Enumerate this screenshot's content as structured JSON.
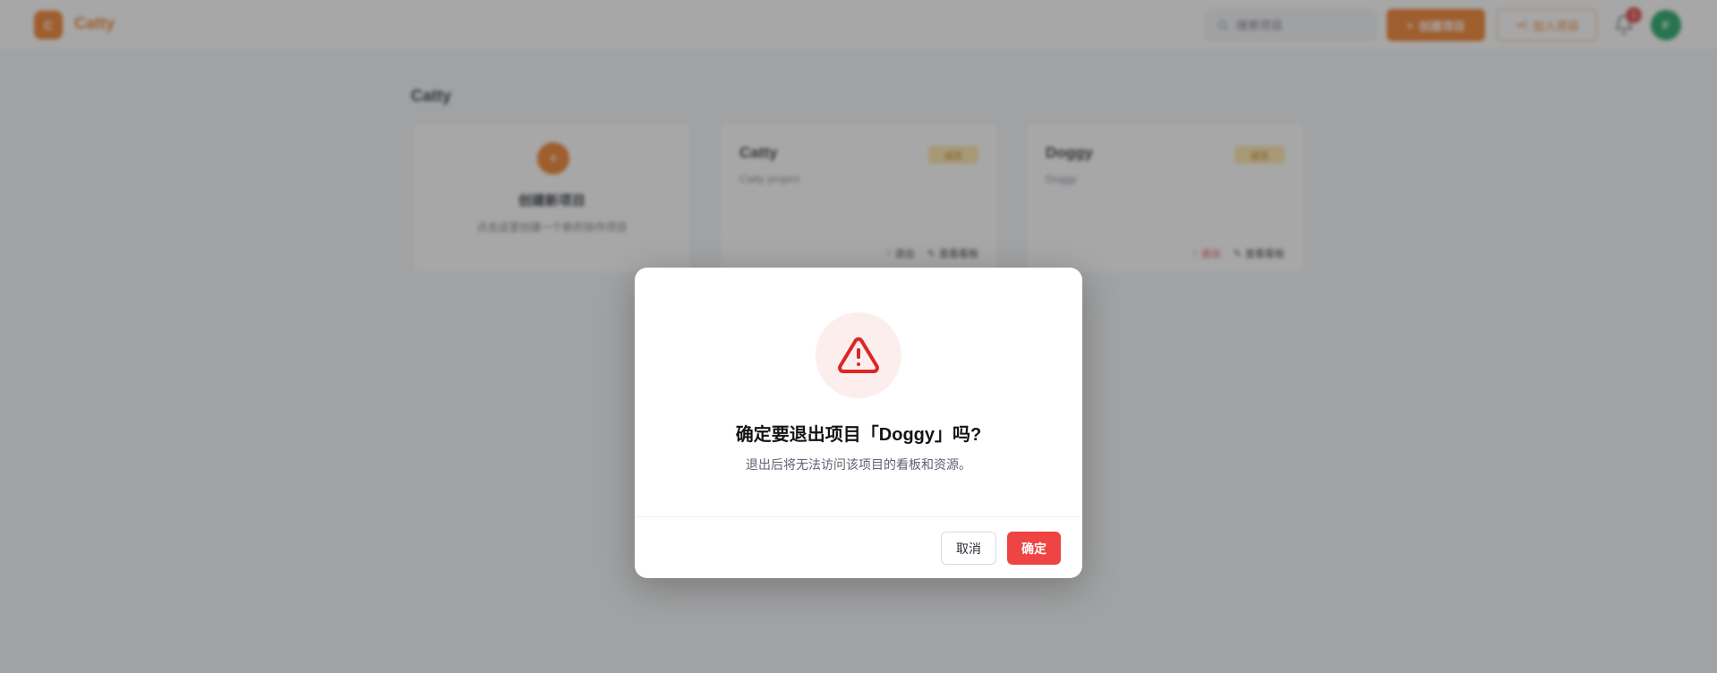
{
  "header": {
    "logo_letter": "C",
    "app_title": "Catty",
    "search_placeholder": "搜索项目",
    "create_button": "创建项目",
    "join_button": "加入项目",
    "notification_count": "1",
    "avatar_initial": "F"
  },
  "main": {
    "page_title": "Catty",
    "create_card": {
      "plus": "+",
      "title": "创建新项目",
      "subtitle": "点击这里创建一个新的协作项目"
    },
    "projects": [
      {
        "name": "Catty",
        "description": "Catty project",
        "badge": "成员",
        "action1": "退出",
        "action2": "查看看板"
      },
      {
        "name": "Doggy",
        "description": "Doggy",
        "badge": "成员",
        "action1": "退出",
        "action2": "查看看板"
      }
    ]
  },
  "modal": {
    "icon": "warning-triangle-icon",
    "title": "确定要退出项目「Doggy」吗?",
    "description": "退出后将无法访问该项目的看板和资源。",
    "cancel_label": "取消",
    "confirm_label": "确定"
  },
  "colors": {
    "accent": "#f07a22",
    "danger": "#ef4444",
    "overlay": "rgba(60,60,60,0.45)"
  }
}
